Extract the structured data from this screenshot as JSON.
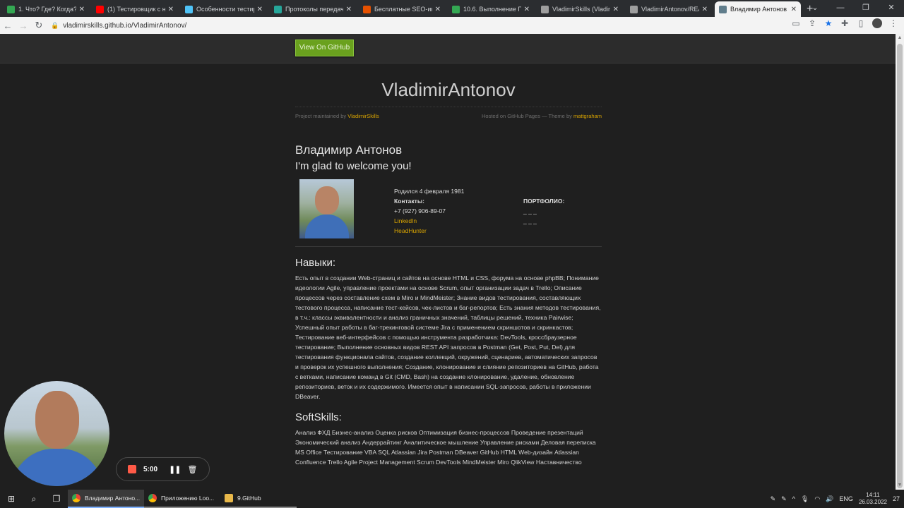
{
  "browser": {
    "tabs": [
      {
        "title": "1. Что? Где? Когда? | ...",
        "color": "#34a853"
      },
      {
        "title": "(1) Тестировщик с ну...",
        "color": "#ff0000"
      },
      {
        "title": "Особенности тестир...",
        "color": "#4fc3f7"
      },
      {
        "title": "Протоколы передач...",
        "color": "#26a69a"
      },
      {
        "title": "Бесплатные SEO-инс...",
        "color": "#e65100"
      },
      {
        "title": "10.6. Выполнение Пр...",
        "color": "#34a853"
      },
      {
        "title": "VladimirSkills (Vladim...",
        "color": "#9e9e9e"
      },
      {
        "title": "VladimirAntonov/REA...",
        "color": "#9e9e9e"
      },
      {
        "title": "Владимир Антонов |",
        "color": "#607d8b"
      }
    ],
    "new_tab_label": "+",
    "url": "vladimirskills.github.io/VladimirAntonov/"
  },
  "page": {
    "github_button": "View On GitHub",
    "site_title": "VladimirAntonov",
    "maintained_by_prefix": "Project maintained by",
    "maintainer": "VladimirSkills",
    "hosted_text": "Hosted on GitHub Pages — Theme by",
    "theme_author": "mattgraham",
    "name": "Владимир Антонов",
    "welcome": "I'm glad to welcome you!",
    "born": "Родился 4 февраля 1981",
    "contacts_label": "Контакты:",
    "phone": "+7 (927) 906-89-07",
    "linkedin": "LinkedIn",
    "headhunter": "HeadHunter",
    "portfolio_label": "ПОРТФОЛИО:",
    "portfolio_items": [
      "_ _ _",
      "_ _ _"
    ],
    "skills_title": "Навыки:",
    "skills_text": "Есть опыт в создании Web-страниц и сайтов на основе HTML и CSS, форума на основе phpBB; Понимание идеологии Agile, управление проектами на основе Scrum, опыт организации задач в Trello; Описание процессов через составление схем в Miro и MindMeister; Знание видов тестирования, составляющих тестового процесса, написание тест-кейсов, чек-листов и баг-репортов; Есть знания методов тестирования, в т.ч.: классы эквивалентности и анализ граничных значений, таблицы решений, техника Pairwise; Успешный опыт работы в баг-трекинговой системе Jira с применением скриншотов и скринкастов; Тестирование веб-интерфейсов с помощью инструмента разработчика: DevTools, кроссбраузерное тестирование; Выполнение основных видов REST API запросов в Postman (Get, Post, Put, Del) для тестирования функционала сайтов, создание коллекций, окружений, сценариев, автоматических запросов и проверок их успешного выполнения; Создание, клонирование и слияние репозиториев на GitHub, работа с ветками, написание команд в Git (CMD, Bash) на создание клонирование, удаление, обновление репозиториев, веток и их содержимого. Имеется опыт в написании SQL-запросов, работы в приложении DBeaver.",
    "softskills_title": "SoftSkills:",
    "softskills_text": "Анализ ФХД Бизнес-анализ Оценка рисков Оптимизация бизнес-процессов Проведение презентаций Экономический анализ Андеррайтинг Аналитическое мышление Управление рисками Деловая переписка MS Office Тестирование VBA SQL Atlassian Jira Postman DBeaver GitHub HTML Web-дизайн Atlassian Confluence Trello Agile Project Management Scrum DevTools MindMeister Miro QlikView Наставничество"
  },
  "recorder": {
    "time": "5:00"
  },
  "taskbar": {
    "apps": [
      {
        "label": "Владимир Антоно...",
        "type": "chrome",
        "state": "active"
      },
      {
        "label": "Приложению Loo...",
        "type": "chrome",
        "state": "open"
      },
      {
        "label": "9.GitHub",
        "type": "folder",
        "state": "open"
      }
    ],
    "lang": "ENG",
    "time": "14:11",
    "date": "26.03.2022",
    "notifications": "27"
  }
}
